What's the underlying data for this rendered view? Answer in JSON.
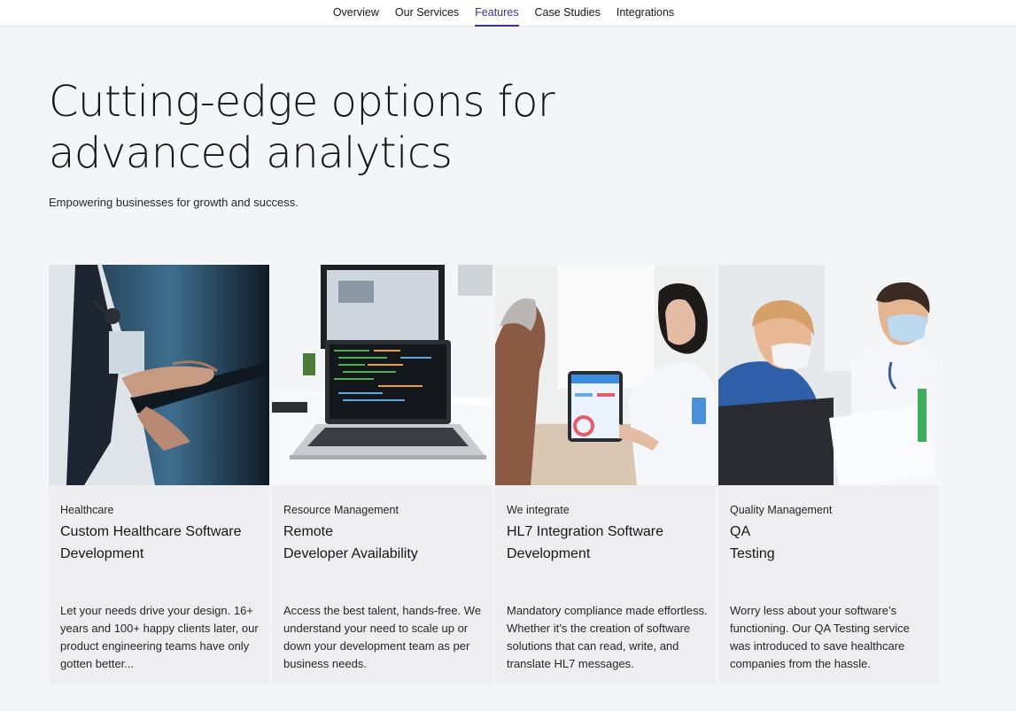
{
  "nav": {
    "items": [
      {
        "label": "Overview"
      },
      {
        "label": "Our Services"
      },
      {
        "label": "Features",
        "active": true
      },
      {
        "label": "Case Studies"
      },
      {
        "label": "Integrations"
      }
    ]
  },
  "hero": {
    "title": "Cutting-edge options for advanced analytics",
    "subtitle": "Empowering businesses for growth and success."
  },
  "cards": [
    {
      "kicker": "Healthcare",
      "title": "Custom Healthcare Software\nDevelopment",
      "description": "Let your needs drive your design. 16+ years and 100+ happy clients later, our product engineering teams have only gotten better..."
    },
    {
      "kicker": "Resource Management",
      "title": "Remote\nDeveloper Availability",
      "description": "Access the best talent, hands-free. We understand your need to scale up or down your development team as per business needs."
    },
    {
      "kicker": "We integrate",
      "title": "HL7 Integration Software\nDevelopment",
      "description": "Mandatory compliance made effortless. Whether it’s the creation of software solutions that can read, write, and translate HL7 messages."
    },
    {
      "kicker": "Quality Management",
      "title": "QA\nTesting",
      "description": "Worry less about your software’s functioning. Our QA Testing service was introduced to save healthcare companies from the hassle."
    }
  ],
  "colors": {
    "accent": "#3b2f8f",
    "page_bg": "#f4f5f8",
    "card_bg": "#eeeef0"
  }
}
